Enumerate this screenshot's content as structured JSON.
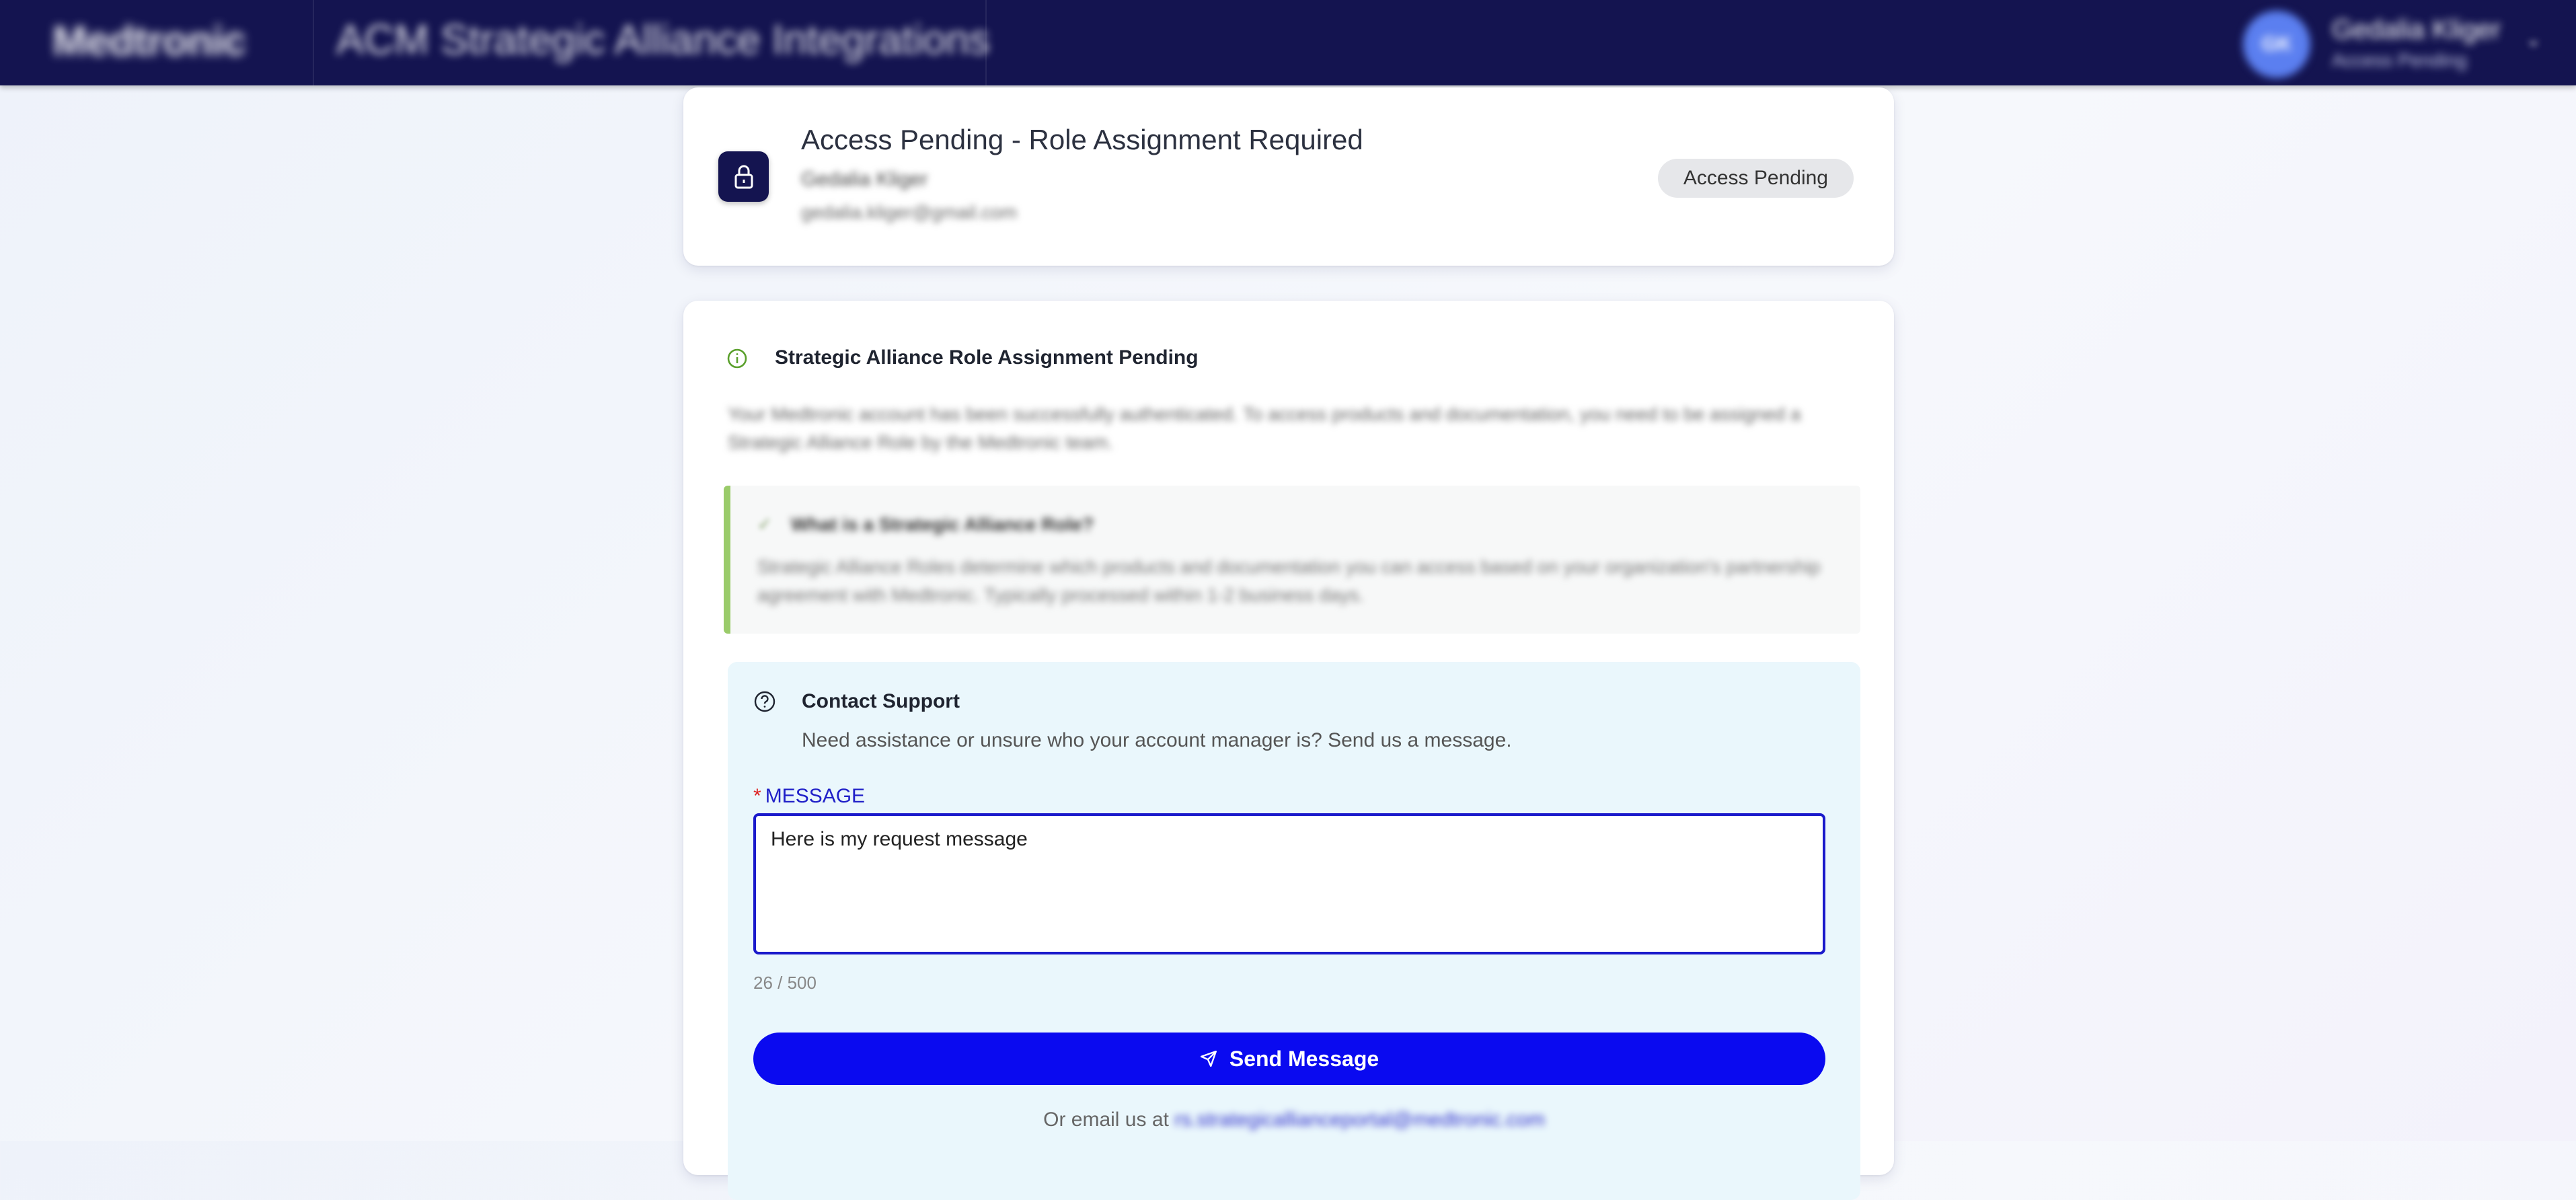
{
  "header": {
    "logo_text": "Medtronic",
    "app_title": "ACM Strategic Alliance Integrations",
    "user": {
      "initials": "GK",
      "name": "Gedalia Kliger",
      "role": "Access Pending"
    }
  },
  "access_card": {
    "title": "Access Pending - Role Assignment Required",
    "user_name": "Gedalia Kliger",
    "user_email": "gedalia.kliger@gmail.com",
    "status": "Access Pending"
  },
  "pending_card": {
    "title": "Strategic Alliance Role Assignment Pending",
    "description": "Your Medtronic account has been successfully authenticated. To access products and documentation, you need to be assigned a Strategic Alliance Role by the Medtronic team.",
    "callout": {
      "title": "What is a Strategic Alliance Role?",
      "text": "Strategic Alliance Roles determine which products and documentation you can access based on your organization's partnership agreement with Medtronic. Typically processed within 1-2 business days."
    }
  },
  "support": {
    "title": "Contact Support",
    "subtitle": "Need assistance or unsure who your account manager is? Send us a message.",
    "message_label": "MESSAGE",
    "required_mark": "*",
    "message_value": "Here is my request message",
    "char_count": "26 / 500",
    "send_label": "Send Message",
    "email_prefix": "Or email us at",
    "email_address": "rs.strategicallianceportal@medtronic.com"
  },
  "colors": {
    "header_bg": "#141450",
    "primary_button": "#0a0af0",
    "input_border": "#1a1acb",
    "callout_accent": "#9acb6a",
    "support_bg": "#eaf7fc",
    "status_badge_bg": "#e6e7ea"
  }
}
